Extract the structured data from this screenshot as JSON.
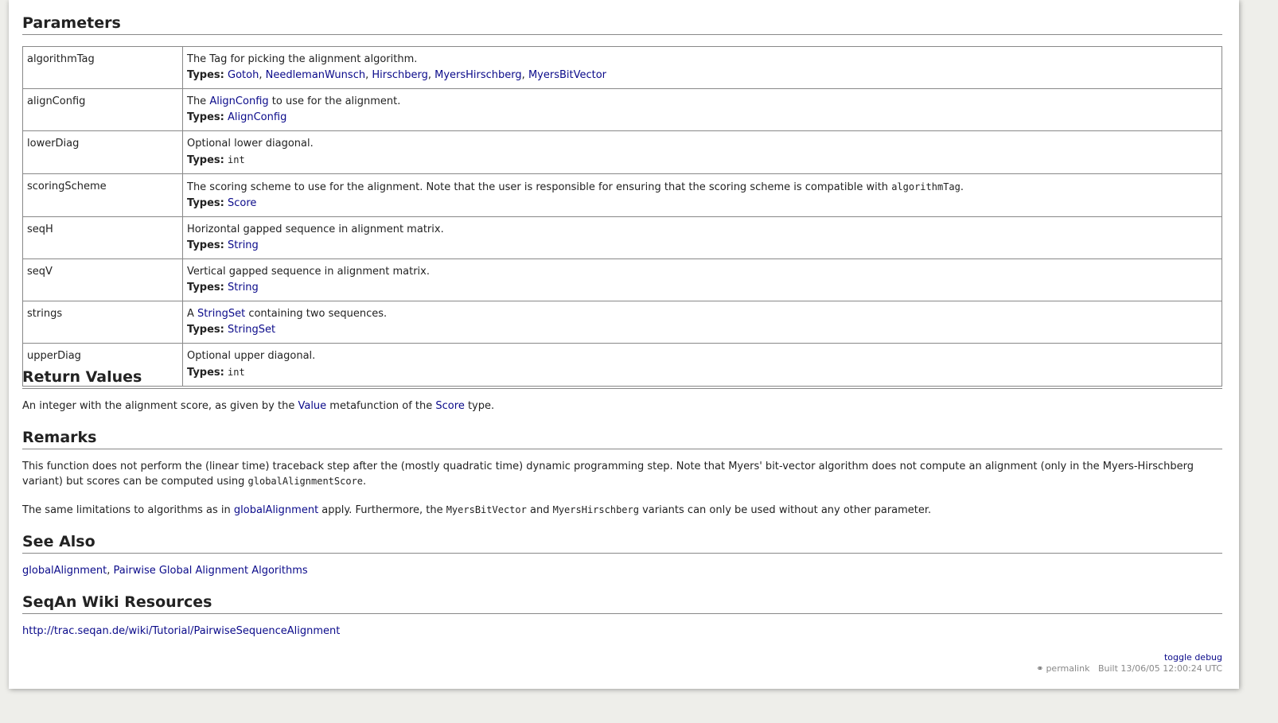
{
  "sections": {
    "parameters": "Parameters",
    "return_values": "Return Values",
    "remarks": "Remarks",
    "see_also": "See Also",
    "wiki": "SeqAn Wiki Resources"
  },
  "types_label": "Types:",
  "params": [
    {
      "name": "algorithmTag",
      "desc": "The Tag for picking the alignment algorithm.",
      "types": [
        "Gotoh",
        "NeedlemanWunsch",
        "Hirschberg",
        "MyersHirschberg",
        "MyersBitVector"
      ]
    },
    {
      "name": "alignConfig",
      "desc_pre": "The ",
      "desc_link": "AlignConfig",
      "desc_post": " to use for the alignment.",
      "types": [
        "AlignConfig"
      ]
    },
    {
      "name": "lowerDiag",
      "desc": "Optional lower diagonal.",
      "type_code": "int"
    },
    {
      "name": "scoringScheme",
      "desc": "The scoring scheme to use for the alignment. Note that the user is responsible for ensuring that the scoring scheme is compatible with ",
      "desc_code": "algorithmTag",
      "desc_end": ".",
      "types": [
        "Score"
      ]
    },
    {
      "name": "seqH",
      "desc": "Horizontal gapped sequence in alignment matrix.",
      "types": [
        "String"
      ]
    },
    {
      "name": "seqV",
      "desc": "Vertical gapped sequence in alignment matrix.",
      "types": [
        "String"
      ]
    },
    {
      "name": "strings",
      "desc_pre": "A ",
      "desc_link": "StringSet",
      "desc_post": " containing two sequences.",
      "types": [
        "StringSet"
      ]
    },
    {
      "name": "upperDiag",
      "desc": "Optional upper diagonal.",
      "type_code": "int"
    }
  ],
  "return_values": {
    "pre": "An integer with the alignment score, as given by the ",
    "link1": "Value",
    "mid": " metafunction of the ",
    "link2": "Score",
    "post": " type."
  },
  "remarks": {
    "p1_text": "This function does not perform the (linear time) traceback step after the (mostly quadratic time) dynamic programming step. Note that Myers' bit-vector algorithm does not compute an alignment (only in the Myers-Hirschberg variant) but scores can be computed using ",
    "p1_code": "globalAlignmentScore",
    "p1_end": ".",
    "p2_pre": "The same limitations to algorithms as in ",
    "p2_link": "globalAlignment",
    "p2_mid": " apply. Furthermore, the ",
    "p2_code1": "MyersBitVector",
    "p2_and": " and ",
    "p2_code2": "MyersHirschberg",
    "p2_post": " variants can only be used without any other parameter."
  },
  "see_also": {
    "link1": "globalAlignment",
    "sep": ", ",
    "link2": "Pairwise Global Alignment Algorithms"
  },
  "wiki_link": "http://trac.seqan.de/wiki/Tutorial/PairwiseSequenceAlignment",
  "footer": {
    "toggle_debug": "toggle debug",
    "permalink": "permalink",
    "built": "Built 13/06/05 12:00:24 UTC"
  },
  "colors": {
    "link": "#0a0a8a",
    "page_bg": "#eeeeea",
    "border": "#888888"
  }
}
